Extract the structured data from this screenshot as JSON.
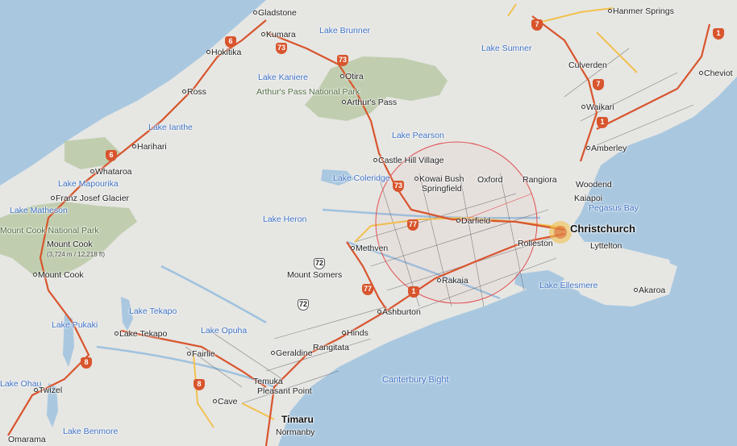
{
  "map": {
    "places": [
      {
        "name": "Gladstone"
      },
      {
        "name": "Kumara"
      },
      {
        "name": "Hokitika"
      },
      {
        "name": "Ross"
      },
      {
        "name": "Otira"
      },
      {
        "name": "Arthur's Pass"
      },
      {
        "name": "Harihari"
      },
      {
        "name": "Whataroa"
      },
      {
        "name": "Franz Josef Glacier"
      },
      {
        "name": "Castle Hill Village"
      },
      {
        "name": "Kowai Bush"
      },
      {
        "name": "Oxford"
      },
      {
        "name": "Rangiora"
      },
      {
        "name": "Woodend"
      },
      {
        "name": "Springfield"
      },
      {
        "name": "Kaiapoi"
      },
      {
        "name": "Darfield"
      },
      {
        "name": "Christchurch"
      },
      {
        "name": "Rolleston"
      },
      {
        "name": "Lyttelton"
      },
      {
        "name": "Methven"
      },
      {
        "name": "Mount Somers"
      },
      {
        "name": "Rakaia"
      },
      {
        "name": "Ashburton"
      },
      {
        "name": "Akaroa"
      },
      {
        "name": "Hinds"
      },
      {
        "name": "Rangitata"
      },
      {
        "name": "Geraldine"
      },
      {
        "name": "Fairlie"
      },
      {
        "name": "Lake Tekapo"
      },
      {
        "name": "Mount Cook"
      },
      {
        "name": "Temuka"
      },
      {
        "name": "Pleasant Point"
      },
      {
        "name": "Cave"
      },
      {
        "name": "Timaru"
      },
      {
        "name": "Normanby"
      },
      {
        "name": "Twizel"
      },
      {
        "name": "Omarama"
      },
      {
        "name": "Hanmer Springs"
      },
      {
        "name": "Culverden"
      },
      {
        "name": "Waikari"
      },
      {
        "name": "Amberley"
      },
      {
        "name": "Cheviot"
      }
    ],
    "water_labels": [
      "Lake Brunner",
      "Lake Kaniere",
      "Lake Sumner",
      "Lake Ianthe",
      "Lake Pearson",
      "Lake Mapourika",
      "Lake Coleridge",
      "Lake Matheson",
      "Lake Heron",
      "Pegasus Bay",
      "Lake Ellesmere",
      "Lake Tekapo",
      "Lake Pukaki",
      "Lake Opuha",
      "Lake Ohau",
      "Lake Benmore",
      "Canterbury Bight"
    ],
    "parks": [
      "Arthur's Pass National Park",
      "Mount Cook National Park"
    ],
    "peak_elevation": "(3,724 m / 12,218 ft)",
    "route_shields": [
      "6",
      "73",
      "73",
      "7",
      "7",
      "1",
      "1",
      "6",
      "73",
      "77",
      "72",
      "77",
      "72",
      "1",
      "8",
      "8",
      "1"
    ],
    "colors": {
      "sea": "#a9c8e0",
      "land": "#e6e6e3",
      "park": "#b8c9a6",
      "highway": "#d8552d",
      "road": "#f2c14e",
      "radius": "#e05050"
    }
  }
}
